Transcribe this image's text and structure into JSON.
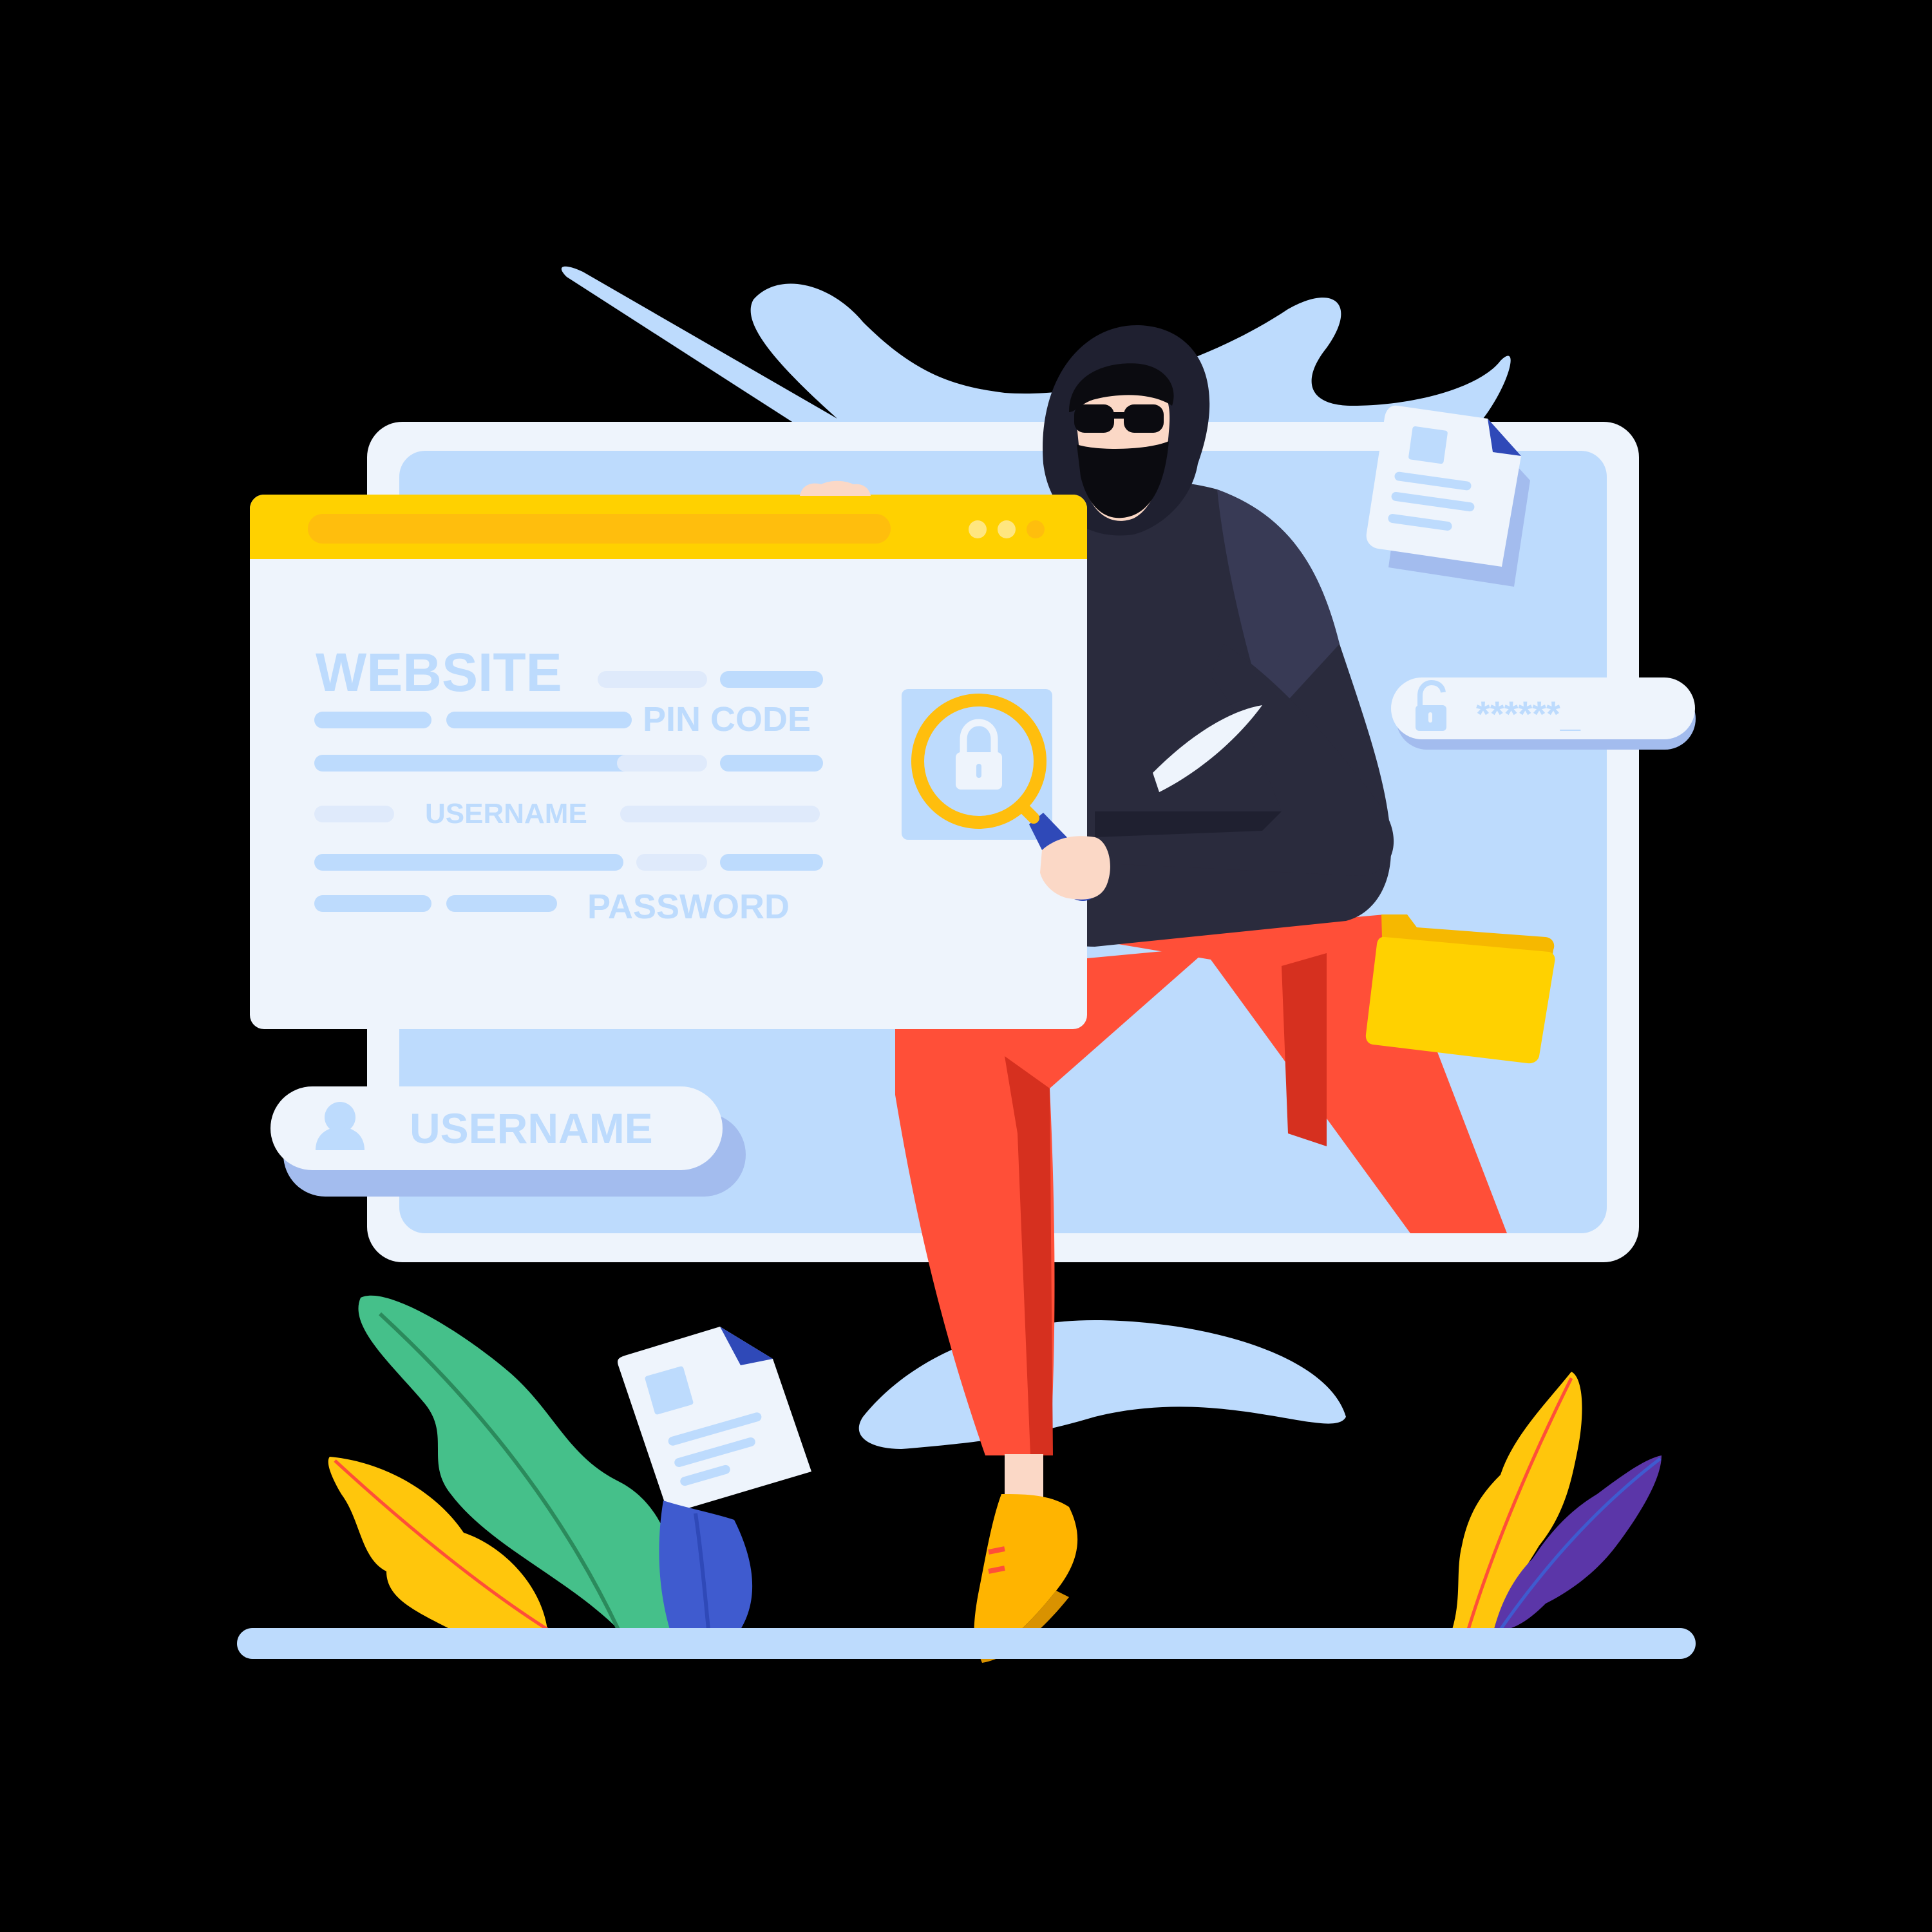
{
  "colors": {
    "background": "#000000",
    "blob": "#bddbfd",
    "panel": "#eef4fc",
    "panel_inner": "#bddbfd",
    "panel_shadow": "#a3bcee",
    "title_bar": "#ffd100",
    "title_track": "#ffbe0d",
    "bar": "#bddbfd",
    "bar_light": "#dfeafb",
    "label_text": "#bddbfd",
    "hoodie": "#2a2b3d",
    "hoodie_light": "#383a55",
    "mask": "#0b0b10",
    "skin": "#fbd8c6",
    "pants": "#ff4f38",
    "pants_shadow": "#d6301f",
    "shoes": "#ffb400",
    "magnifier": "#ffbe0d",
    "folder": "#ffd100",
    "folder_back": "#f6b800",
    "doc_image": "#bddbfd",
    "doc_corner": "#2f49b8",
    "leaf_green": "#45c08a",
    "leaf_yellow": "#ffc60c",
    "leaf_blue": "#3f5bcf",
    "leaf_purple": "#5b36a8",
    "ground": "#bddbfd"
  },
  "browser": {
    "title": "WEBSITE",
    "pin_label": "PIN CODE",
    "username_label": "USERNAME",
    "password_label": "PASSWORD",
    "window_dots": [
      "dot-1",
      "dot-2",
      "dot-3"
    ]
  },
  "username_pill": {
    "label": "USERNAME",
    "icon": "user-icon"
  },
  "password_pill": {
    "mask": "******_",
    "icon": "unlock-icon"
  },
  "magnifier": {
    "icon": "lock-icon"
  }
}
